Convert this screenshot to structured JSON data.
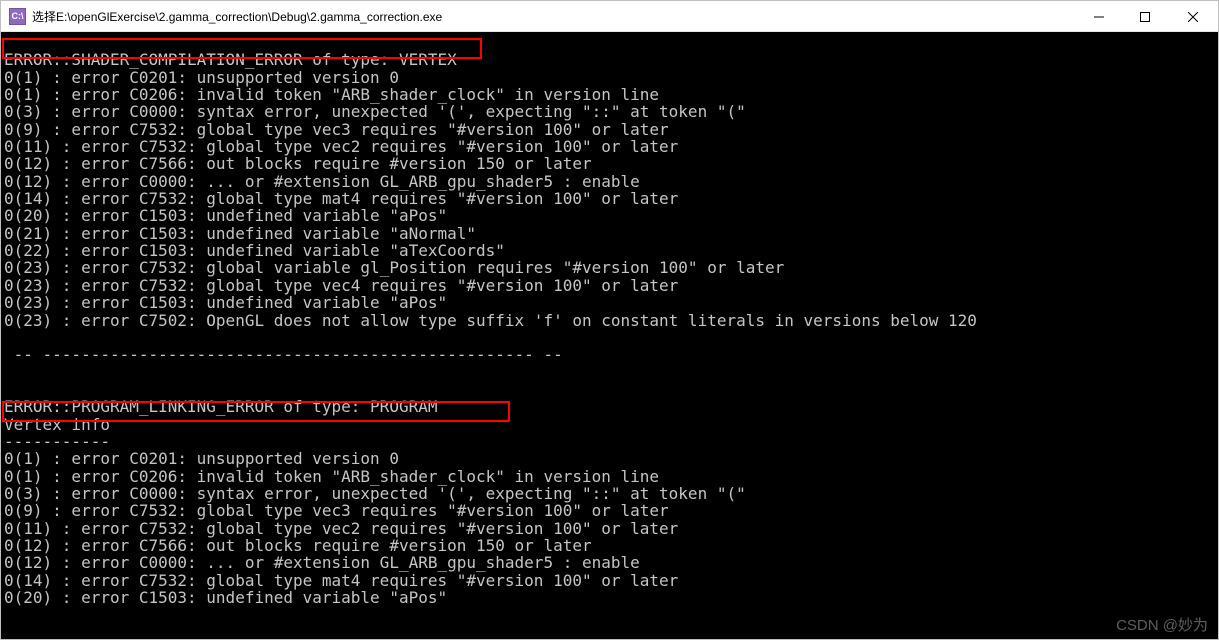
{
  "title": "选择E:\\openGlExercise\\2.gamma_correction\\Debug\\2.gamma_correction.exe",
  "icon_label": "C:\\",
  "lines": [
    "",
    "ERROR::SHADER_COMPILATION_ERROR of type: VERTEX",
    "0(1) : error C0201: unsupported version 0",
    "0(1) : error C0206: invalid token \"ARB_shader_clock\" in version line",
    "0(3) : error C0000: syntax error, unexpected '(', expecting \"::\" at token \"(\"",
    "0(9) : error C7532: global type vec3 requires \"#version 100\" or later",
    "0(11) : error C7532: global type vec2 requires \"#version 100\" or later",
    "0(12) : error C7566: out blocks require #version 150 or later",
    "0(12) : error C0000: ... or #extension GL_ARB_gpu_shader5 : enable",
    "0(14) : error C7532: global type mat4 requires \"#version 100\" or later",
    "0(20) : error C1503: undefined variable \"aPos\"",
    "0(21) : error C1503: undefined variable \"aNormal\"",
    "0(22) : error C1503: undefined variable \"aTexCoords\"",
    "0(23) : error C7532: global variable gl_Position requires \"#version 100\" or later",
    "0(23) : error C7532: global type vec4 requires \"#version 100\" or later",
    "0(23) : error C1503: undefined variable \"aPos\"",
    "0(23) : error C7502: OpenGL does not allow type suffix 'f' on constant literals in versions below 120",
    "",
    " -- --------------------------------------------------- --",
    "",
    "",
    "ERROR::PROGRAM_LINKING_ERROR of type: PROGRAM",
    "Vertex info",
    "-----------",
    "0(1) : error C0201: unsupported version 0",
    "0(1) : error C0206: invalid token \"ARB_shader_clock\" in version line",
    "0(3) : error C0000: syntax error, unexpected '(', expecting \"::\" at token \"(\"",
    "0(9) : error C7532: global type vec3 requires \"#version 100\" or later",
    "0(11) : error C7532: global type vec2 requires \"#version 100\" or later",
    "0(12) : error C7566: out blocks require #version 150 or later",
    "0(12) : error C0000: ... or #extension GL_ARB_gpu_shader5 : enable",
    "0(14) : error C7532: global type mat4 requires \"#version 100\" or later",
    "0(20) : error C1503: undefined variable \"aPos\""
  ],
  "watermark": "CSDN @妙为"
}
